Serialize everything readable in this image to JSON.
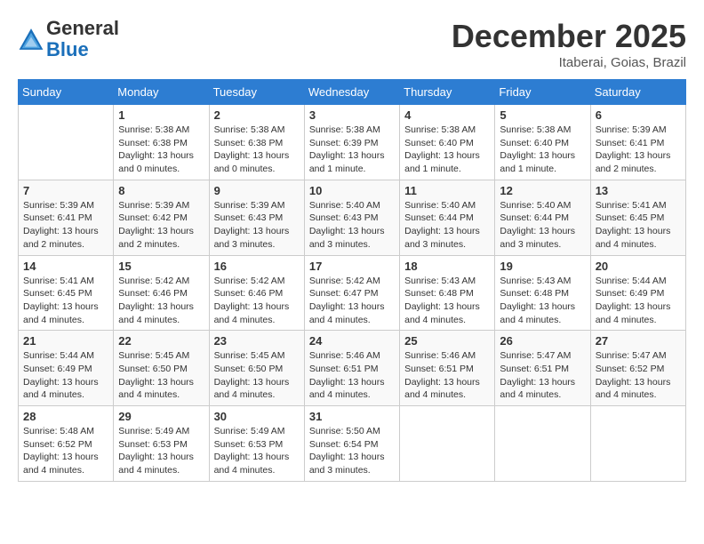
{
  "header": {
    "logo_line1": "General",
    "logo_line2": "Blue",
    "month": "December 2025",
    "location": "Itaberai, Goias, Brazil"
  },
  "days_of_week": [
    "Sunday",
    "Monday",
    "Tuesday",
    "Wednesday",
    "Thursday",
    "Friday",
    "Saturday"
  ],
  "weeks": [
    [
      {
        "day": "",
        "info": ""
      },
      {
        "day": "1",
        "info": "Sunrise: 5:38 AM\nSunset: 6:38 PM\nDaylight: 13 hours\nand 0 minutes."
      },
      {
        "day": "2",
        "info": "Sunrise: 5:38 AM\nSunset: 6:38 PM\nDaylight: 13 hours\nand 0 minutes."
      },
      {
        "day": "3",
        "info": "Sunrise: 5:38 AM\nSunset: 6:39 PM\nDaylight: 13 hours\nand 1 minute."
      },
      {
        "day": "4",
        "info": "Sunrise: 5:38 AM\nSunset: 6:40 PM\nDaylight: 13 hours\nand 1 minute."
      },
      {
        "day": "5",
        "info": "Sunrise: 5:38 AM\nSunset: 6:40 PM\nDaylight: 13 hours\nand 1 minute."
      },
      {
        "day": "6",
        "info": "Sunrise: 5:39 AM\nSunset: 6:41 PM\nDaylight: 13 hours\nand 2 minutes."
      }
    ],
    [
      {
        "day": "7",
        "info": "Sunrise: 5:39 AM\nSunset: 6:41 PM\nDaylight: 13 hours\nand 2 minutes."
      },
      {
        "day": "8",
        "info": "Sunrise: 5:39 AM\nSunset: 6:42 PM\nDaylight: 13 hours\nand 2 minutes."
      },
      {
        "day": "9",
        "info": "Sunrise: 5:39 AM\nSunset: 6:43 PM\nDaylight: 13 hours\nand 3 minutes."
      },
      {
        "day": "10",
        "info": "Sunrise: 5:40 AM\nSunset: 6:43 PM\nDaylight: 13 hours\nand 3 minutes."
      },
      {
        "day": "11",
        "info": "Sunrise: 5:40 AM\nSunset: 6:44 PM\nDaylight: 13 hours\nand 3 minutes."
      },
      {
        "day": "12",
        "info": "Sunrise: 5:40 AM\nSunset: 6:44 PM\nDaylight: 13 hours\nand 3 minutes."
      },
      {
        "day": "13",
        "info": "Sunrise: 5:41 AM\nSunset: 6:45 PM\nDaylight: 13 hours\nand 4 minutes."
      }
    ],
    [
      {
        "day": "14",
        "info": "Sunrise: 5:41 AM\nSunset: 6:45 PM\nDaylight: 13 hours\nand 4 minutes."
      },
      {
        "day": "15",
        "info": "Sunrise: 5:42 AM\nSunset: 6:46 PM\nDaylight: 13 hours\nand 4 minutes."
      },
      {
        "day": "16",
        "info": "Sunrise: 5:42 AM\nSunset: 6:46 PM\nDaylight: 13 hours\nand 4 minutes."
      },
      {
        "day": "17",
        "info": "Sunrise: 5:42 AM\nSunset: 6:47 PM\nDaylight: 13 hours\nand 4 minutes."
      },
      {
        "day": "18",
        "info": "Sunrise: 5:43 AM\nSunset: 6:48 PM\nDaylight: 13 hours\nand 4 minutes."
      },
      {
        "day": "19",
        "info": "Sunrise: 5:43 AM\nSunset: 6:48 PM\nDaylight: 13 hours\nand 4 minutes."
      },
      {
        "day": "20",
        "info": "Sunrise: 5:44 AM\nSunset: 6:49 PM\nDaylight: 13 hours\nand 4 minutes."
      }
    ],
    [
      {
        "day": "21",
        "info": "Sunrise: 5:44 AM\nSunset: 6:49 PM\nDaylight: 13 hours\nand 4 minutes."
      },
      {
        "day": "22",
        "info": "Sunrise: 5:45 AM\nSunset: 6:50 PM\nDaylight: 13 hours\nand 4 minutes."
      },
      {
        "day": "23",
        "info": "Sunrise: 5:45 AM\nSunset: 6:50 PM\nDaylight: 13 hours\nand 4 minutes."
      },
      {
        "day": "24",
        "info": "Sunrise: 5:46 AM\nSunset: 6:51 PM\nDaylight: 13 hours\nand 4 minutes."
      },
      {
        "day": "25",
        "info": "Sunrise: 5:46 AM\nSunset: 6:51 PM\nDaylight: 13 hours\nand 4 minutes."
      },
      {
        "day": "26",
        "info": "Sunrise: 5:47 AM\nSunset: 6:51 PM\nDaylight: 13 hours\nand 4 minutes."
      },
      {
        "day": "27",
        "info": "Sunrise: 5:47 AM\nSunset: 6:52 PM\nDaylight: 13 hours\nand 4 minutes."
      }
    ],
    [
      {
        "day": "28",
        "info": "Sunrise: 5:48 AM\nSunset: 6:52 PM\nDaylight: 13 hours\nand 4 minutes."
      },
      {
        "day": "29",
        "info": "Sunrise: 5:49 AM\nSunset: 6:53 PM\nDaylight: 13 hours\nand 4 minutes."
      },
      {
        "day": "30",
        "info": "Sunrise: 5:49 AM\nSunset: 6:53 PM\nDaylight: 13 hours\nand 4 minutes."
      },
      {
        "day": "31",
        "info": "Sunrise: 5:50 AM\nSunset: 6:54 PM\nDaylight: 13 hours\nand 3 minutes."
      },
      {
        "day": "",
        "info": ""
      },
      {
        "day": "",
        "info": ""
      },
      {
        "day": "",
        "info": ""
      }
    ]
  ]
}
